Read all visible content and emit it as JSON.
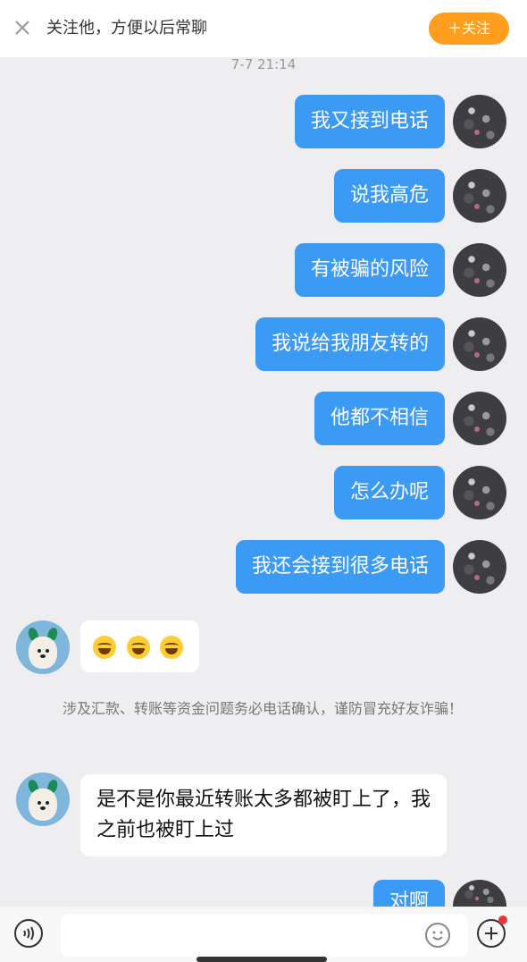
{
  "header": {
    "follow_tip": "关注他，方便以后常聊",
    "follow_button": "＋关注"
  },
  "timestamp": "7-7 21:14",
  "outgoing_messages": [
    "我又接到电话",
    "说我高危",
    "有被骗的风险",
    "我说给我朋友转的",
    "他都不相信",
    "怎么办呢",
    "我还会接到很多电话",
    "对啊"
  ],
  "incoming_messages": {
    "emoji_message_icons": [
      "laughing-tears-emoji",
      "laughing-tears-emoji",
      "laughing-tears-emoji"
    ],
    "text_message": "是不是你最近转账太多都被盯上了，我之前也被盯上过"
  },
  "system_notice": "涉及汇款、转账等资金问题务必电话确认，谨防冒充好友诈骗！",
  "colors": {
    "accent": "#ff9d1e",
    "outgoing_bubble": "#3b9af4",
    "background": "#eeeef0"
  }
}
